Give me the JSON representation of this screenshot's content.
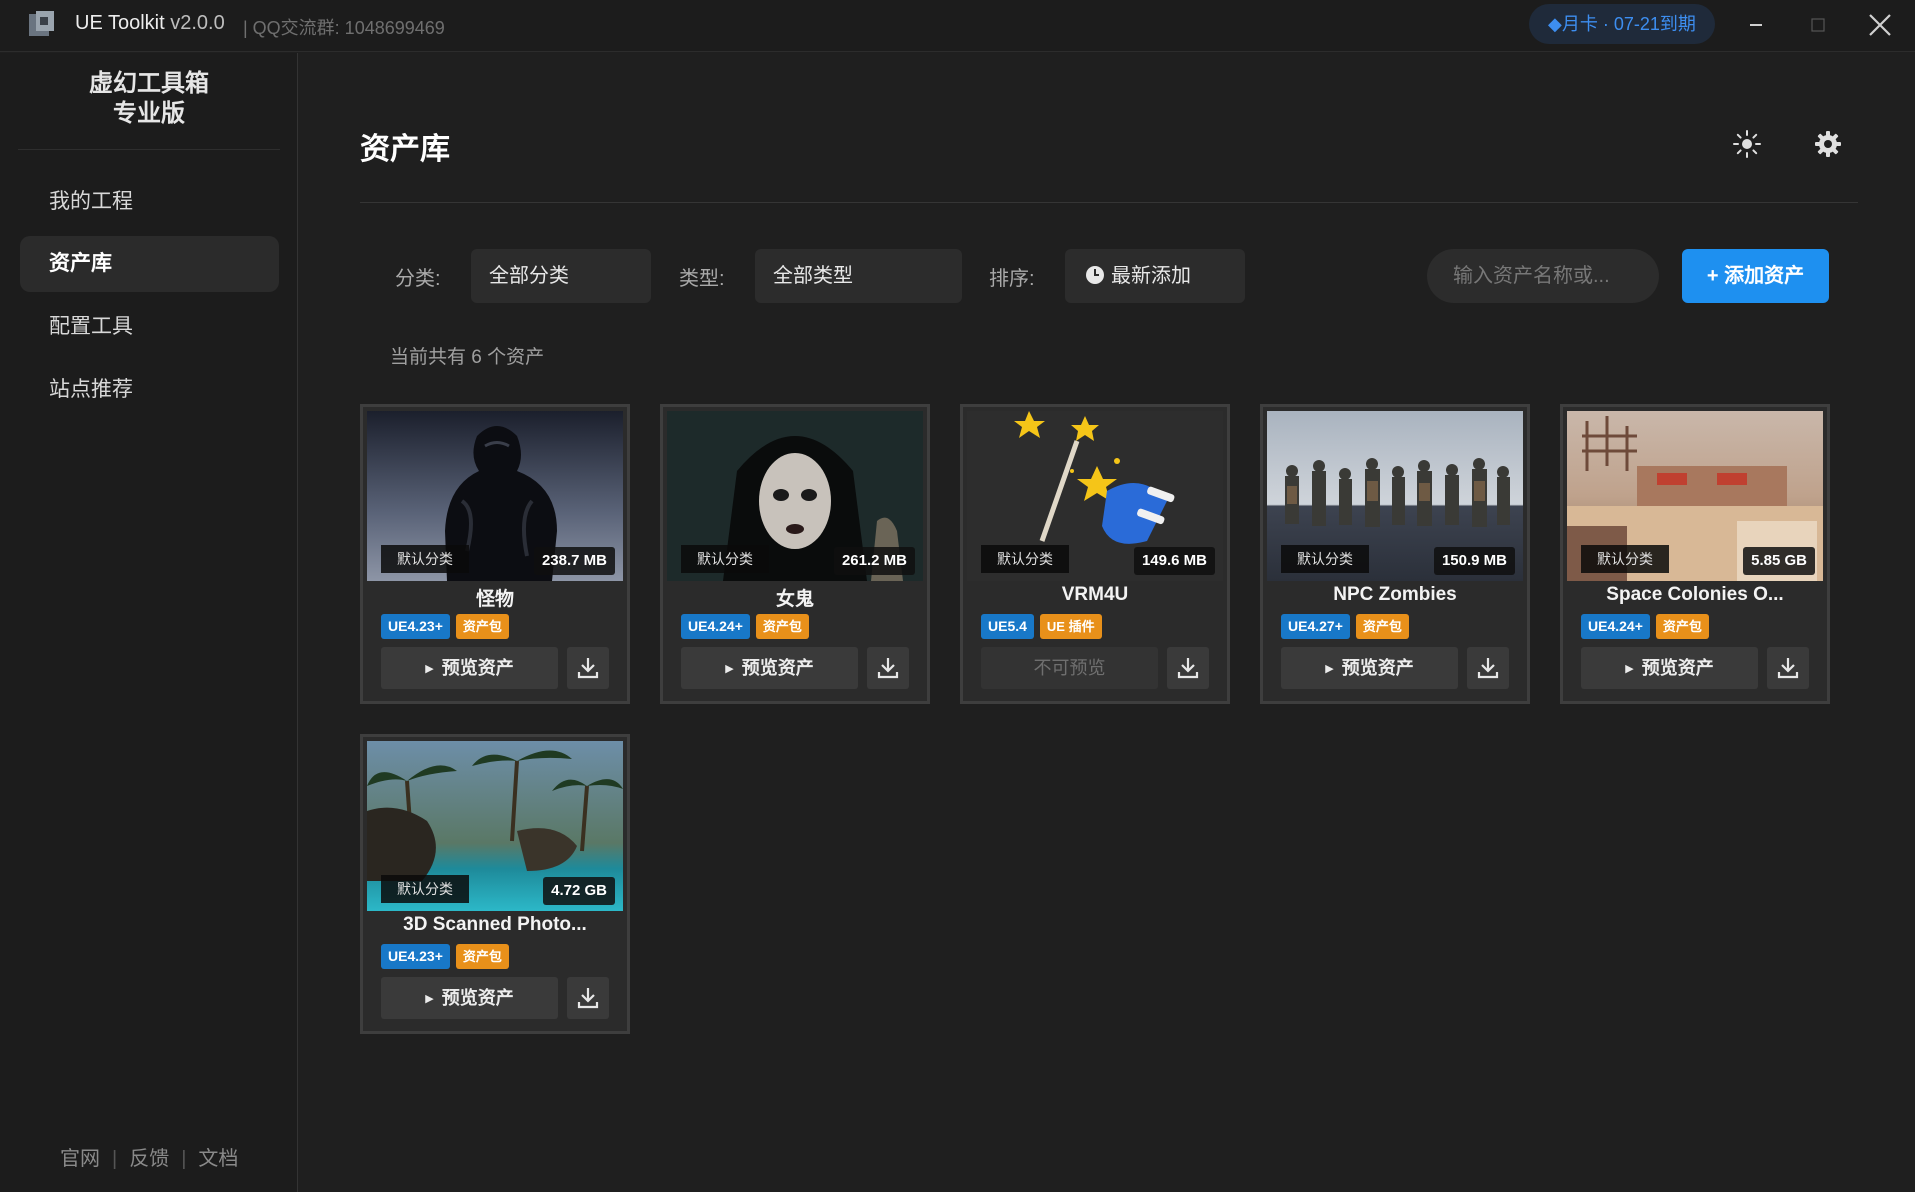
{
  "titlebar": {
    "app_name": "UE Toolkit",
    "version": "v2.0.0",
    "qq_group": "| QQ交流群: 1048699469",
    "vip_badge": "◆月卡 · 07-21到期",
    "minimize_icon": "minimize-icon",
    "maximize_icon": "maximize-icon",
    "close_icon": "close-icon"
  },
  "sidebar": {
    "brand_line1": "虚幻工具箱",
    "brand_line2": "专业版",
    "items": [
      {
        "label": "我的工程",
        "active": false
      },
      {
        "label": "资产库",
        "active": true
      },
      {
        "label": "配置工具",
        "active": false
      },
      {
        "label": "站点推荐",
        "active": false
      }
    ],
    "footer": {
      "official": "官网",
      "feedback": "反馈",
      "docs": "文档"
    }
  },
  "header": {
    "title": "资产库",
    "theme_icon": "sun-icon",
    "settings_icon": "gear-icon"
  },
  "filters": {
    "category_label": "分类:",
    "category_value": "全部分类",
    "type_label": "类型:",
    "type_value": "全部类型",
    "sort_label": "排序:",
    "sort_value": "最新添加",
    "search_placeholder": "输入资产名称或...",
    "add_button": "+ 添加资产"
  },
  "count_text": "当前共有 6 个资产",
  "assets": [
    {
      "name": "怪物",
      "category": "默认分类",
      "size": "238.7 MB",
      "version": "UE4.23+",
      "type": "资产包",
      "preview": "预览资产",
      "previewable": true
    },
    {
      "name": "女鬼",
      "category": "默认分类",
      "size": "261.2 MB",
      "version": "UE4.24+",
      "type": "资产包",
      "preview": "预览资产",
      "previewable": true
    },
    {
      "name": "VRM4U",
      "category": "默认分类",
      "size": "149.6 MB",
      "version": "UE5.4",
      "type": "UE 插件",
      "preview": "不可预览",
      "previewable": false
    },
    {
      "name": "NPC Zombies",
      "category": "默认分类",
      "size": "150.9 MB",
      "version": "UE4.27+",
      "type": "资产包",
      "preview": "预览资产",
      "previewable": true
    },
    {
      "name": "Space Colonies O...",
      "category": "默认分类",
      "size": "5.85 GB",
      "version": "UE4.24+",
      "type": "资产包",
      "preview": "预览资产",
      "previewable": true
    },
    {
      "name": "3D Scanned Photo...",
      "category": "默认分类",
      "size": "4.72 GB",
      "version": "UE4.23+",
      "type": "资产包",
      "preview": "预览资产",
      "previewable": true
    }
  ],
  "colors": {
    "accent": "#1e90f0",
    "version_badge": "#1878c8",
    "type_badge": "#e8901a"
  }
}
